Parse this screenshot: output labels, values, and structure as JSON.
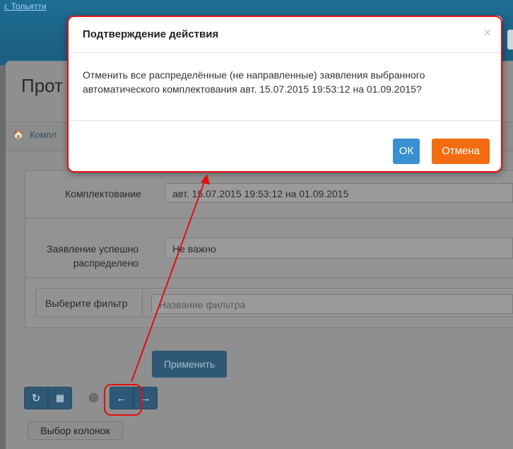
{
  "header": {
    "city_link": "г. Тольятти"
  },
  "page": {
    "title": "Прот",
    "breadcrumb": "Компл"
  },
  "filters": {
    "completion_label": "Комплектование",
    "completion_value": "авт. 15.07.2015 19:53:12 на 01.09.2015",
    "distributed_label_line1": "Заявление успешно",
    "distributed_label_line2": "распределено",
    "distributed_value": "Не важно",
    "filter_button": "Выберите фильтр",
    "filter_placeholder": "Название фильтра",
    "apply_label": "Применить"
  },
  "toolbar": {
    "refresh_icon": "refresh-icon",
    "grid_icon": "grid-icon",
    "prev_icon": "arrow-left-icon",
    "next_icon": "arrow-right-icon",
    "columns_label": "Выбор колонок"
  },
  "modal": {
    "title": "Подтверждение действия",
    "close_glyph": "×",
    "body_line1": "Отменить все распределённые (не направленные) заявления выбранного",
    "body_line2": "автоматического комплектования авт. 15.07.2015 19:53:12 на 01.09.2015?",
    "ok_label": "ОК",
    "cancel_label": "Отмена"
  },
  "colors": {
    "ok": "#3a8fd0",
    "cancel": "#f36c11",
    "annotation": "#e01010"
  }
}
